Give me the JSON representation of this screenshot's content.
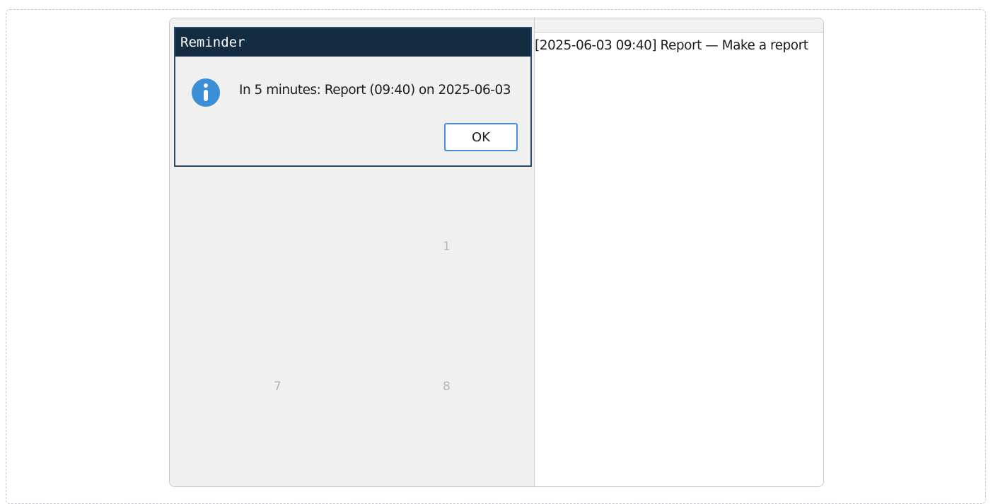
{
  "dialog": {
    "title": "Reminder",
    "icon": "info-icon",
    "message": "In 5 minutes: Report (09:40) on 2025-06-03",
    "ok_label": "OK"
  },
  "calendar": {
    "days": [
      "1",
      "7",
      "8"
    ]
  },
  "events": {
    "items": [
      "[2025-06-03 09:40] Report — Make a report"
    ]
  },
  "colors": {
    "dialog_titlebar": "#132c42",
    "dialog_border": "#2d4a6a",
    "info_icon": "#3a8fd6",
    "ok_button_border": "#4a8fd4",
    "panel_background": "#f0f0f0"
  }
}
